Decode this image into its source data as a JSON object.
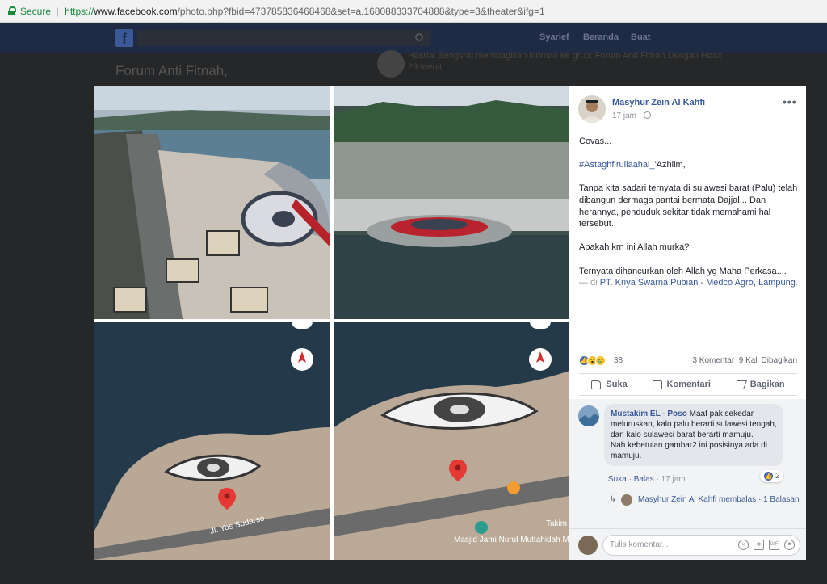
{
  "browser": {
    "secure_label": "Secure",
    "url_scheme": "https://",
    "url_host": "www.facebook.com",
    "url_rest": "/photo.php?fbid=473785836468468&set=a.168088333704888&type=3&theater&ifg=1"
  },
  "background": {
    "nav": [
      "Syarief",
      "Beranda",
      "Buat"
    ],
    "group_title": "Forum Anti Fitnah,",
    "post_text": "Hasrial Bengsrat membagikan kiriman ke grup: Forum Anti Fitnah Dengan Hoax",
    "post_time": "29 menit"
  },
  "photos": {
    "map_labels": {
      "street": "Jl. Yos Sudarso",
      "mosque": "Masjid Jami Nurul Muttahidah Mamuju",
      "edge_label": "Takim"
    }
  },
  "post": {
    "author": "Masyhur Zein Al Kahfi",
    "time": "17 jam ·",
    "more": "•••",
    "line1": "Covas...",
    "hashtag": "#Astaghfirullaahal_",
    "hashtag_suffix": "'Azhiim,",
    "para1": "Tanpa kita sadari ternyata di sulawesi barat (Palu) telah dibangun dermaga pantai bermata Dajjal... Dan herannya, penduduk sekitar tidak memahami hal tersebut.",
    "para2": "Apakah krn ini Allah murka?",
    "para3": "Ternyata dihancurkan oleh Allah yg Maha Perkasa....",
    "location_prefix": "— di",
    "location": "PT. Kriya Swarna Pubian - Medco Agro, Lampung",
    "location_suffix": "."
  },
  "reactions": {
    "count": "38",
    "comments": "3 Komentar",
    "shares": "9 Kali Dibagikan"
  },
  "actions": {
    "like": "Suka",
    "comment": "Komentari",
    "share": "Bagikan"
  },
  "comment": {
    "author": "Mustakim EL - Poso",
    "text": "Maaf pak sekedar meluruskan, kalo palu berarti sulawesi tengah, dan kalo sulawesi barat berarti mamuju.",
    "text2": "Nah kebetulan gambar2 ini posisinya ada di mamuju.",
    "like": "Suka",
    "dot": "·",
    "reply": "Balas",
    "time": "· 17 jam",
    "likes": "2"
  },
  "reply": {
    "text": "Masyhur Zein Al Kahfi membalas · 1 Balasan"
  },
  "composer": {
    "placeholder": "Tulis komentar..."
  },
  "colors": {
    "link": "#365899",
    "like_blue": "#4267b2"
  }
}
